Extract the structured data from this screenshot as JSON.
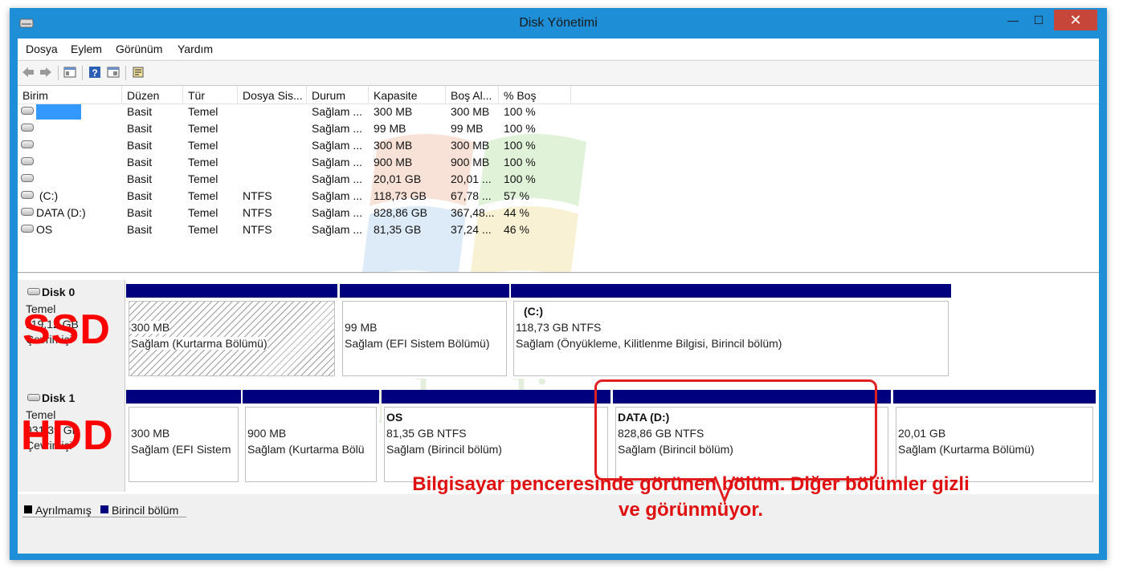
{
  "window": {
    "title": "Disk Yönetimi",
    "minimize": "—",
    "maximize": "☐",
    "close": "✕"
  },
  "menu": [
    "Dosya",
    "Eylem",
    "Görünüm",
    "Yardım"
  ],
  "toolbar": {
    "icons": [
      "back-icon",
      "forward-icon",
      "console-icon",
      "help-icon",
      "properties-icon",
      "settings-icon"
    ]
  },
  "list": {
    "columns": [
      "Birim",
      "Düzen",
      "Tür",
      "Dosya Sis...",
      "Durum",
      "Kapasite",
      "Boş Al...",
      "% Boş"
    ],
    "rows": [
      {
        "name": "",
        "layout": "Basit",
        "type": "Temel",
        "fs": "",
        "status": "Sağlam ...",
        "capacity": "300 MB",
        "free": "300 MB",
        "pct": "100 %"
      },
      {
        "name": "",
        "layout": "Basit",
        "type": "Temel",
        "fs": "",
        "status": "Sağlam ...",
        "capacity": "99 MB",
        "free": "99 MB",
        "pct": "100 %"
      },
      {
        "name": "",
        "layout": "Basit",
        "type": "Temel",
        "fs": "",
        "status": "Sağlam ...",
        "capacity": "300 MB",
        "free": "300 MB",
        "pct": "100 %"
      },
      {
        "name": "",
        "layout": "Basit",
        "type": "Temel",
        "fs": "",
        "status": "Sağlam ...",
        "capacity": "900 MB",
        "free": "900 MB",
        "pct": "100 %"
      },
      {
        "name": "",
        "layout": "Basit",
        "type": "Temel",
        "fs": "",
        "status": "Sağlam ...",
        "capacity": "20,01 GB",
        "free": "20,01 ...",
        "pct": "100 %"
      },
      {
        "name": " (C:)",
        "layout": "Basit",
        "type": "Temel",
        "fs": "NTFS",
        "status": "Sağlam ...",
        "capacity": "118,73 GB",
        "free": "67,78 ...",
        "pct": "57 %"
      },
      {
        "name": "DATA (D:)",
        "layout": "Basit",
        "type": "Temel",
        "fs": "NTFS",
        "status": "Sağlam ...",
        "capacity": "828,86 GB",
        "free": "367,48...",
        "pct": "44 %"
      },
      {
        "name": "OS",
        "layout": "Basit",
        "type": "Temel",
        "fs": "NTFS",
        "status": "Sağlam ...",
        "capacity": "81,35 GB",
        "free": "37,24 ...",
        "pct": "46 %"
      }
    ]
  },
  "disks": [
    {
      "name": "Disk 0",
      "type": "Temel",
      "size": "119,12 GB",
      "state": "Çevrimiçi",
      "overlay": "SSD",
      "partitions": [
        {
          "title": "",
          "size": "300 MB",
          "status": "Sağlam (Kurtarma Bölümü)"
        },
        {
          "title": "",
          "size": "99 MB",
          "status": "Sağlam (EFI Sistem Bölümü)"
        },
        {
          "title": "(C:)",
          "size": "118,73 GB NTFS",
          "status": "Sağlam (Önyükleme, Kilitlenme Bilgisi, Birincil bölüm)"
        }
      ]
    },
    {
      "name": "Disk 1",
      "type": "Temel",
      "size": "931,39 GB",
      "state": "Çevrimiçi",
      "overlay": "HDD",
      "partitions": [
        {
          "title": "",
          "size": "300 MB",
          "status": "Sağlam (EFI Sistem"
        },
        {
          "title": "",
          "size": "900 MB",
          "status": "Sağlam (Kurtarma Bölü"
        },
        {
          "title": "OS",
          "size": "81,35 GB NTFS",
          "status": "Sağlam (Birincil bölüm)"
        },
        {
          "title": "DATA  (D:)",
          "size": "828,86 GB NTFS",
          "status": "Sağlam (Birincil bölüm)"
        },
        {
          "title": "",
          "size": "20,01 GB",
          "status": "Sağlam (Kurtarma Bölümü)"
        }
      ]
    }
  ],
  "legend": {
    "unallocated": "Ayrılmamış",
    "primary": "Birincil bölüm",
    "unallocated_color": "#000000",
    "primary_color": "#00007f"
  },
  "annotation": {
    "line1": "Bilgisayar penceresinde görünen bölüm. Diğer bölümler gizli",
    "line2": "ve görünmüyor.",
    "color": "#e01010"
  },
  "watermark": {
    "text": "enbedi.com"
  }
}
